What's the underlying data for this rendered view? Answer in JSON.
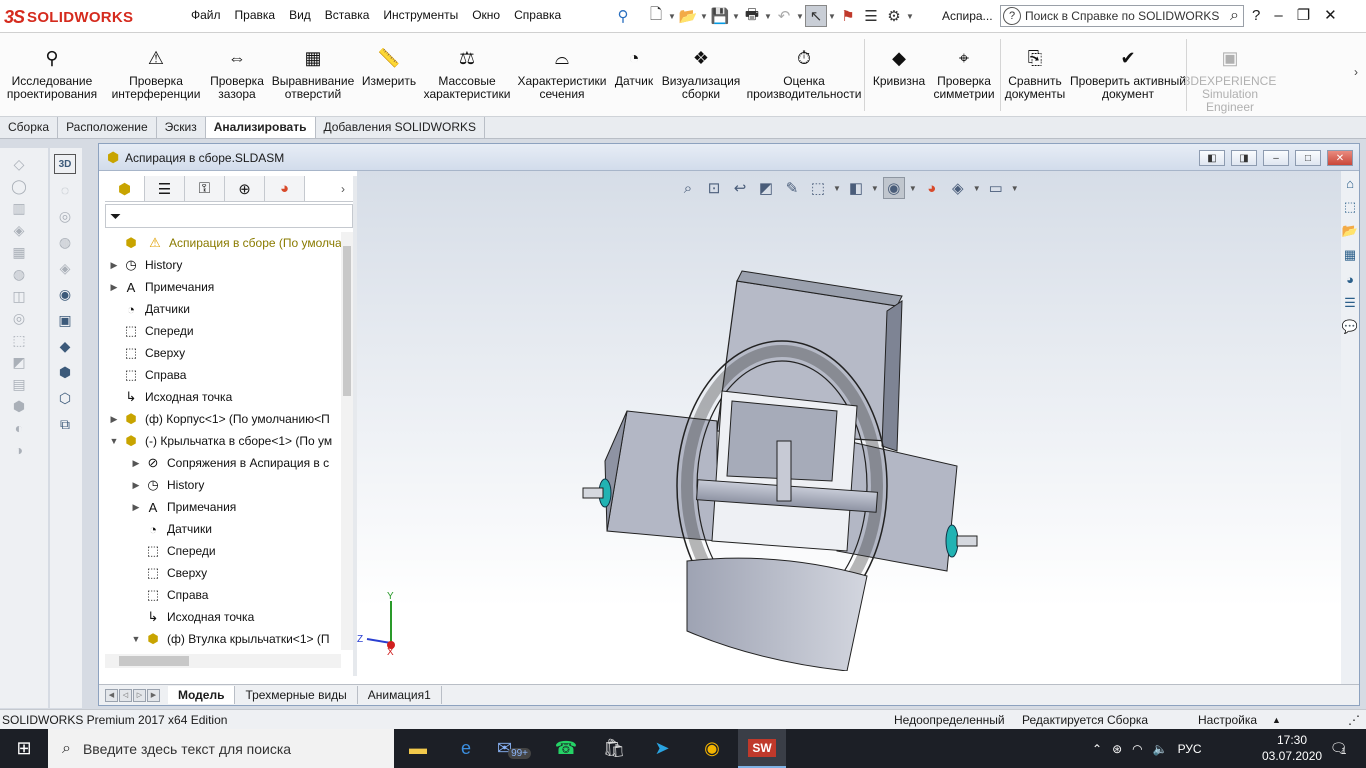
{
  "app": {
    "logo_prefix": "3S",
    "logo_text": "SOLIDWORKS",
    "menus": [
      "Файл",
      "Правка",
      "Вид",
      "Вставка",
      "Инструменты",
      "Окно",
      "Справка"
    ],
    "doc_short": "Аспира...",
    "help_placeholder": "Поиск в Справке по SOLIDWORKS"
  },
  "ribbon": {
    "items": [
      {
        "label": "Исследование проектирования",
        "icon": "design-study-icon"
      },
      {
        "label": "Проверка интерференции",
        "icon": "interference-icon"
      },
      {
        "label": "Проверка зазора",
        "icon": "clearance-icon"
      },
      {
        "label": "Выравнивание отверстий",
        "icon": "hole-align-icon"
      },
      {
        "label": "Измерить",
        "icon": "measure-icon"
      },
      {
        "label": "Массовые характеристики",
        "icon": "mass-props-icon"
      },
      {
        "label": "Характеристики сечения",
        "icon": "section-props-icon"
      },
      {
        "label": "Датчик",
        "icon": "sensor-icon"
      },
      {
        "label": "Визуализация сборки",
        "icon": "assembly-vis-icon"
      },
      {
        "label": "Оценка производительности",
        "icon": "performance-icon"
      },
      {
        "label": "Кривизна",
        "icon": "curvature-icon"
      },
      {
        "label": "Проверка симметрии",
        "icon": "symmetry-icon"
      },
      {
        "label": "Сравнить документы",
        "icon": "compare-icon"
      },
      {
        "label": "Проверить активный документ",
        "icon": "check-doc-icon"
      },
      {
        "label": "3DEXPERIENCE Simulation Engineer",
        "icon": "3dx-icon",
        "disabled": true
      }
    ]
  },
  "tabs": [
    {
      "label": "Сборка"
    },
    {
      "label": "Расположение"
    },
    {
      "label": "Эскиз"
    },
    {
      "label": "Анализировать",
      "active": true
    },
    {
      "label": "Добавления SOLIDWORKS"
    }
  ],
  "document": {
    "title": "Аспирация в сборе.SLDASM"
  },
  "tree": [
    {
      "label": "Аспирация в сборе  (По умолчан",
      "indent": 0,
      "expander": "",
      "icon": "assembly-icon",
      "warn": true
    },
    {
      "label": "History",
      "indent": 0,
      "expander": "▶",
      "icon": "history-icon"
    },
    {
      "label": "Примечания",
      "indent": 0,
      "expander": "▶",
      "icon": "annotations-icon"
    },
    {
      "label": "Датчики",
      "indent": 0,
      "expander": "",
      "icon": "sensors-icon"
    },
    {
      "label": "Спереди",
      "indent": 0,
      "expander": "",
      "icon": "plane-icon"
    },
    {
      "label": "Сверху",
      "indent": 0,
      "expander": "",
      "icon": "plane-icon"
    },
    {
      "label": "Справа",
      "indent": 0,
      "expander": "",
      "icon": "plane-icon"
    },
    {
      "label": "Исходная точка",
      "indent": 0,
      "expander": "",
      "icon": "origin-icon"
    },
    {
      "label": "(ф) Корпус<1> (По умолчанию<П",
      "indent": 0,
      "expander": "▶",
      "icon": "part-icon"
    },
    {
      "label": "(-) Крыльчатка в сборе<1> (По ум",
      "indent": 0,
      "expander": "▼",
      "icon": "subassembly-icon"
    },
    {
      "label": "Сопряжения в Аспирация в с",
      "indent": 1,
      "expander": "▶",
      "icon": "mates-icon"
    },
    {
      "label": "History",
      "indent": 1,
      "expander": "▶",
      "icon": "history-icon"
    },
    {
      "label": "Примечания",
      "indent": 1,
      "expander": "▶",
      "icon": "annotations-icon"
    },
    {
      "label": "Датчики",
      "indent": 1,
      "expander": "",
      "icon": "sensors-icon"
    },
    {
      "label": "Спереди",
      "indent": 1,
      "expander": "",
      "icon": "plane-icon"
    },
    {
      "label": "Сверху",
      "indent": 1,
      "expander": "",
      "icon": "plane-icon"
    },
    {
      "label": "Справа",
      "indent": 1,
      "expander": "",
      "icon": "plane-icon"
    },
    {
      "label": "Исходная точка",
      "indent": 1,
      "expander": "",
      "icon": "origin-icon"
    },
    {
      "label": "(ф) Втулка крыльчатки<1> (П",
      "indent": 1,
      "expander": "▼",
      "icon": "part-icon"
    }
  ],
  "triad": {
    "x": "X",
    "y": "Y",
    "z": "Z"
  },
  "doc_tabs": [
    {
      "label": "Модель",
      "active": true
    },
    {
      "label": "Трехмерные виды"
    },
    {
      "label": "Анимация1"
    }
  ],
  "status": {
    "edition": "SOLIDWORKS Premium 2017 x64 Edition",
    "state": "Недоопределенный",
    "mode": "Редактируется Сборка",
    "custom": "Настройка"
  },
  "taskbar": {
    "search_placeholder": "Введите здесь текст для поиска",
    "mail_badge": "99+",
    "lang": "РУС",
    "time": "17:30",
    "date": "03.07.2020",
    "notif_count": "1"
  },
  "colors": {
    "brand": "#d52b1e",
    "model_body": "#b9bdc9",
    "model_accent": "#21b3b3"
  }
}
